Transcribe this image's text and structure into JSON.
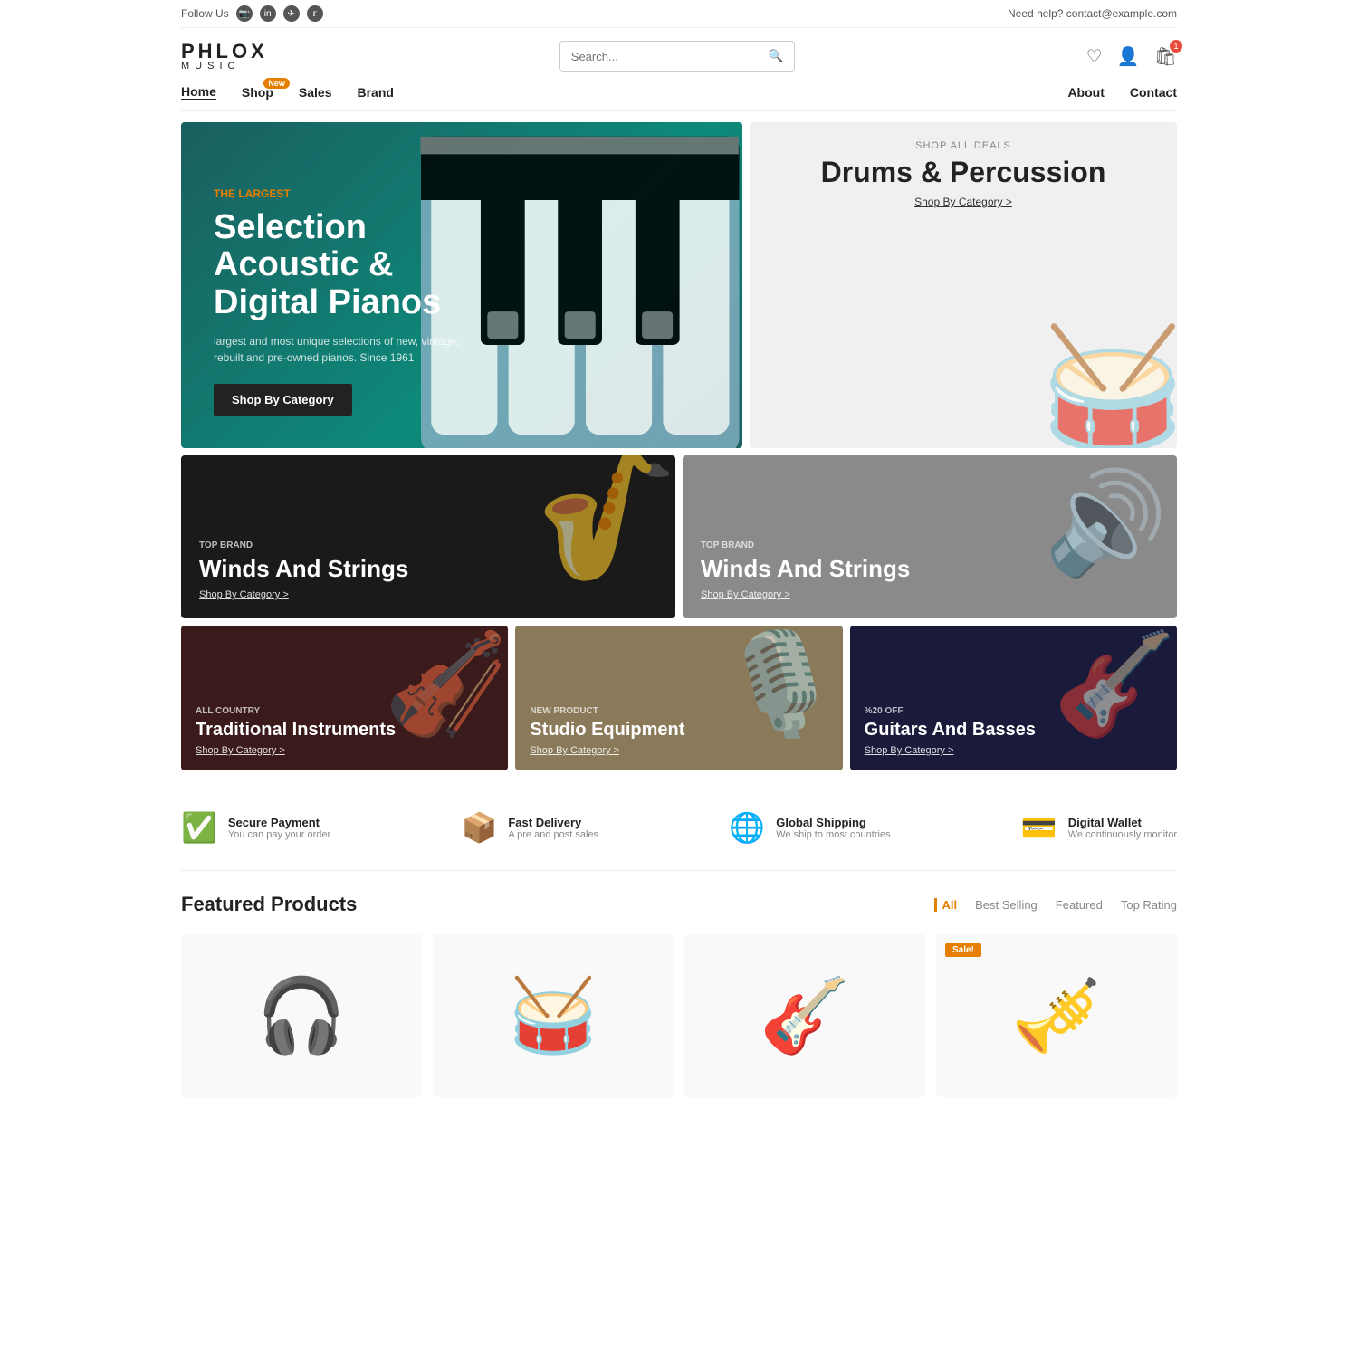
{
  "topbar": {
    "follow_label": "Follow Us",
    "help_text": "Need help? contact@example.com",
    "social_icons": [
      "instagram",
      "linkedin",
      "telegram",
      "twitter"
    ]
  },
  "logo": {
    "top": "PHLOX",
    "bottom": "MUSIC"
  },
  "search": {
    "placeholder": "Search..."
  },
  "cart_count": "1",
  "nav": {
    "left": [
      {
        "label": "Home",
        "active": true,
        "badge": null
      },
      {
        "label": "Shop",
        "active": false,
        "badge": "New"
      },
      {
        "label": "Sales",
        "active": false,
        "badge": null
      },
      {
        "label": "Brand",
        "active": false,
        "badge": null
      }
    ],
    "right": [
      {
        "label": "About"
      },
      {
        "label": "Contact"
      }
    ]
  },
  "hero": {
    "tag": "THE LARGEST",
    "title": "Selection Acoustic & Digital Pianos",
    "desc": "largest and most unique selections of new, vintage, rebuilt and pre-owned pianos. Since 1961",
    "cta": "Shop By Category"
  },
  "drums_banner": {
    "label": "SHOP ALL DEALS",
    "title": "Drums & Percussion",
    "link": "Shop By Category >"
  },
  "winds_dark": {
    "tag": "TOP BRAND",
    "title": "Winds And Strings",
    "link": "Shop By Category >"
  },
  "winds_gray": {
    "tag": "TOP BRAND",
    "title": "Winds And Strings",
    "link": "Shop By Category >"
  },
  "traditional": {
    "tag": "ALL COUNTRY",
    "title": "Traditional Instruments",
    "link": "Shop By Category >"
  },
  "studio": {
    "tag": "NEW PRODUCT",
    "title": "Studio Equipment",
    "link": "Shop By Category >"
  },
  "guitars": {
    "tag": "%20 OFF",
    "title": "Guitars And Basses",
    "link": "Shop By Category >"
  },
  "features": [
    {
      "icon": "✓",
      "title": "Secure Payment",
      "desc": "You can pay your order"
    },
    {
      "icon": "⬚",
      "title": "Fast Delivery",
      "desc": "A pre and post sales"
    },
    {
      "icon": "⊕",
      "title": "Global Shipping",
      "desc": "We ship to most countries"
    },
    {
      "icon": "▬",
      "title": "Digital Wallet",
      "desc": "We continuously monitor"
    }
  ],
  "featured": {
    "title": "Featured Products",
    "tabs": [
      "All",
      "Best Selling",
      "Featured",
      "Top Rating"
    ],
    "active_tab": "All",
    "products": [
      {
        "sale": false,
        "emoji": "🎧"
      },
      {
        "sale": false,
        "emoji": "🥁"
      },
      {
        "sale": false,
        "emoji": "🎸"
      },
      {
        "sale": true,
        "emoji": "🎺"
      }
    ]
  }
}
